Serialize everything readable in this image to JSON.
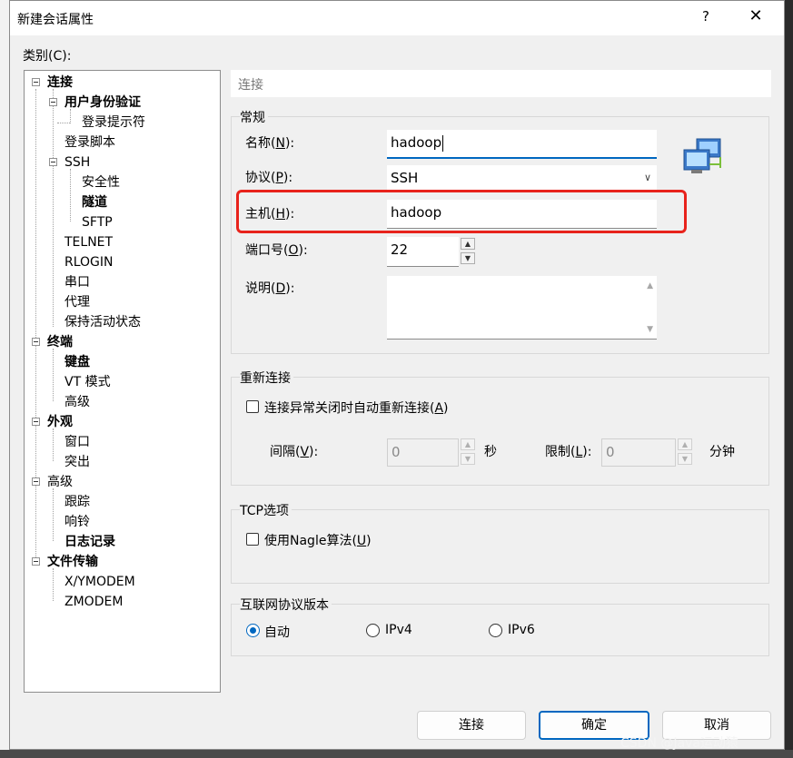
{
  "window": {
    "title": "新建会话属性",
    "help": "?",
    "close": "✕"
  },
  "category_label": "类别(C):",
  "tree": [
    {
      "label": "连接",
      "bold": true
    },
    {
      "label": "用户身份验证",
      "bold": true
    },
    {
      "label": "登录提示符",
      "bold": false
    },
    {
      "label": "登录脚本",
      "bold": false
    },
    {
      "label": "SSH",
      "bold": false
    },
    {
      "label": "安全性",
      "bold": false
    },
    {
      "label": "隧道",
      "bold": true
    },
    {
      "label": "SFTP",
      "bold": false
    },
    {
      "label": "TELNET",
      "bold": false
    },
    {
      "label": "RLOGIN",
      "bold": false
    },
    {
      "label": "串口",
      "bold": false
    },
    {
      "label": "代理",
      "bold": false
    },
    {
      "label": "保持活动状态",
      "bold": false
    },
    {
      "label": "终端",
      "bold": true
    },
    {
      "label": "键盘",
      "bold": true
    },
    {
      "label": "VT 模式",
      "bold": false
    },
    {
      "label": "高级",
      "bold": false
    },
    {
      "label": "外观",
      "bold": true
    },
    {
      "label": "窗口",
      "bold": false
    },
    {
      "label": "突出",
      "bold": false
    },
    {
      "label": "高级",
      "bold": false
    },
    {
      "label": "跟踪",
      "bold": false
    },
    {
      "label": "响铃",
      "bold": false
    },
    {
      "label": "日志记录",
      "bold": true
    },
    {
      "label": "文件传输",
      "bold": true
    },
    {
      "label": "X/YMODEM",
      "bold": false
    },
    {
      "label": "ZMODEM",
      "bold": false
    }
  ],
  "panel": {
    "header": "连接",
    "general": {
      "title": "常规",
      "name_label_a": "名称(",
      "name_label_key": "N",
      "name_label_b": "):",
      "name_value": "hadoop",
      "protocol_label_a": "协议(",
      "protocol_label_key": "P",
      "protocol_label_b": "):",
      "protocol_value": "SSH",
      "host_label_a": "主机(",
      "host_label_key": "H",
      "host_label_b": "):",
      "host_value": "hadoop",
      "port_label_a": "端口号(",
      "port_label_key": "O",
      "port_label_b": "):",
      "port_value": "22",
      "desc_label_a": "说明(",
      "desc_label_key": "D",
      "desc_label_b": "):",
      "desc_value": ""
    },
    "reconnect": {
      "title": "重新连接",
      "checkbox_label_a": "连接异常关闭时自动重新连接(",
      "checkbox_label_key": "A",
      "checkbox_label_b": ")",
      "interval_label_a": "间隔(",
      "interval_label_key": "V",
      "interval_label_b": "):",
      "interval_value": "0",
      "interval_unit": "秒",
      "limit_label_a": "限制(",
      "limit_label_key": "L",
      "limit_label_b": "):",
      "limit_value": "0",
      "limit_unit": "分钟"
    },
    "tcp": {
      "title": "TCP选项",
      "nagle_label_a": "使用Nagle算法(",
      "nagle_label_key": "U",
      "nagle_label_b": ")"
    },
    "ipver": {
      "title": "互联网协议版本",
      "options": [
        "自动",
        "IPv4",
        "IPv6"
      ],
      "selected": "自动"
    }
  },
  "buttons": {
    "connect": "连接",
    "ok": "确定",
    "cancel": "取消"
  },
  "watermark": "CSDN @Java运动猿",
  "colors": {
    "accent": "#0067c0",
    "highlight": "#e8231c"
  }
}
